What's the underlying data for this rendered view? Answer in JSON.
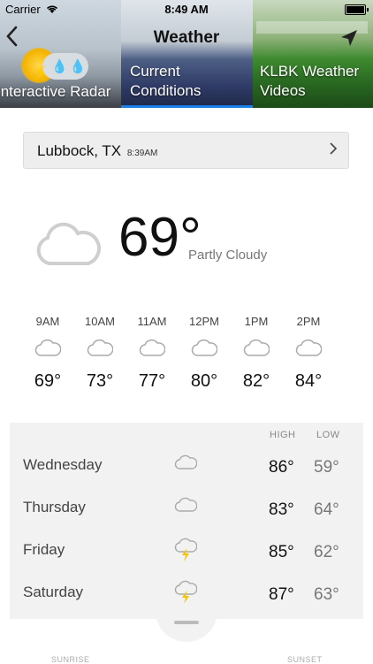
{
  "status_bar": {
    "carrier": "Carrier",
    "time": "8:49 AM"
  },
  "nav": {
    "title": "Weather",
    "back_icon": "chevron-left-icon",
    "locate_icon": "location-arrow-icon"
  },
  "tabs": [
    {
      "label": "Interactive Radar",
      "selected": false
    },
    {
      "label": "Current Conditions",
      "selected": true
    },
    {
      "label": "KLBK Weather Videos",
      "selected": false
    }
  ],
  "location": {
    "city": "Lubbock, TX",
    "time": "8:39AM"
  },
  "current": {
    "temp": "69°",
    "condition": "Partly Cloudy"
  },
  "hourly": [
    {
      "time": "9AM",
      "temp": "69°",
      "icon": "cloud-icon"
    },
    {
      "time": "10AM",
      "temp": "73°",
      "icon": "cloud-icon"
    },
    {
      "time": "11AM",
      "temp": "77°",
      "icon": "cloud-icon"
    },
    {
      "time": "12PM",
      "temp": "80°",
      "icon": "cloud-icon"
    },
    {
      "time": "1PM",
      "temp": "82°",
      "icon": "cloud-icon"
    },
    {
      "time": "2PM",
      "temp": "84°",
      "icon": "cloud-icon"
    }
  ],
  "daily": {
    "high_label": "HIGH",
    "low_label": "LOW",
    "days": [
      {
        "day": "Wednesday",
        "high": "86°",
        "low": "59°",
        "icon": "cloud-icon"
      },
      {
        "day": "Thursday",
        "high": "83°",
        "low": "64°",
        "icon": "cloud-icon"
      },
      {
        "day": "Friday",
        "high": "85°",
        "low": "62°",
        "icon": "thunderstorm-icon"
      },
      {
        "day": "Saturday",
        "high": "87°",
        "low": "63°",
        "icon": "thunderstorm-icon"
      }
    ]
  },
  "footer": {
    "sunrise_label": "SUNRISE",
    "sunset_label": "SUNSET"
  },
  "colors": {
    "accent": "#1a80e8",
    "bolt": "#f5c400"
  }
}
